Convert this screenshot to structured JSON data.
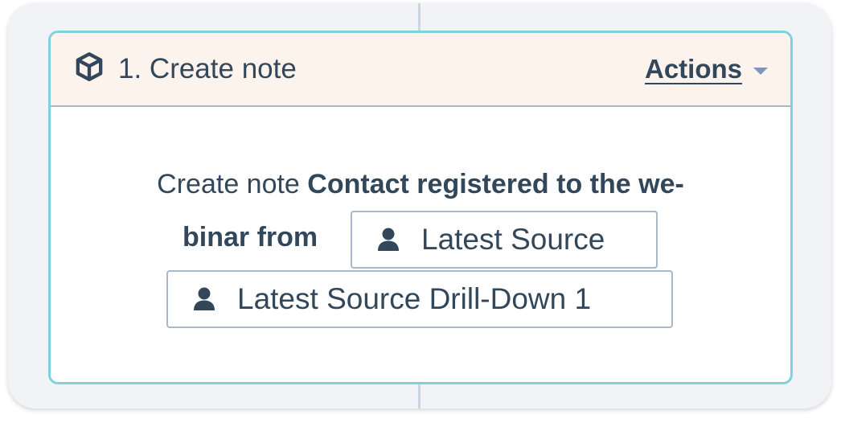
{
  "card": {
    "title": "1. Create note",
    "actions_label": "Actions"
  },
  "body": {
    "prefix": "Create note ",
    "bold_line1": "Contact registered to the we-",
    "bold_line2": "binar from",
    "tokens": [
      {
        "label": "Latest Source",
        "icon": "person-icon"
      },
      {
        "label": "Latest Source Drill-Down 1",
        "icon": "person-icon"
      }
    ]
  },
  "colors": {
    "card_border": "#7fd1de",
    "header_bg": "#fdf3ed",
    "text": "#33475b",
    "caret": "#7c98b6"
  },
  "icons": {
    "header_icon": "cube-icon",
    "actions_icon": "caret-down-icon"
  }
}
